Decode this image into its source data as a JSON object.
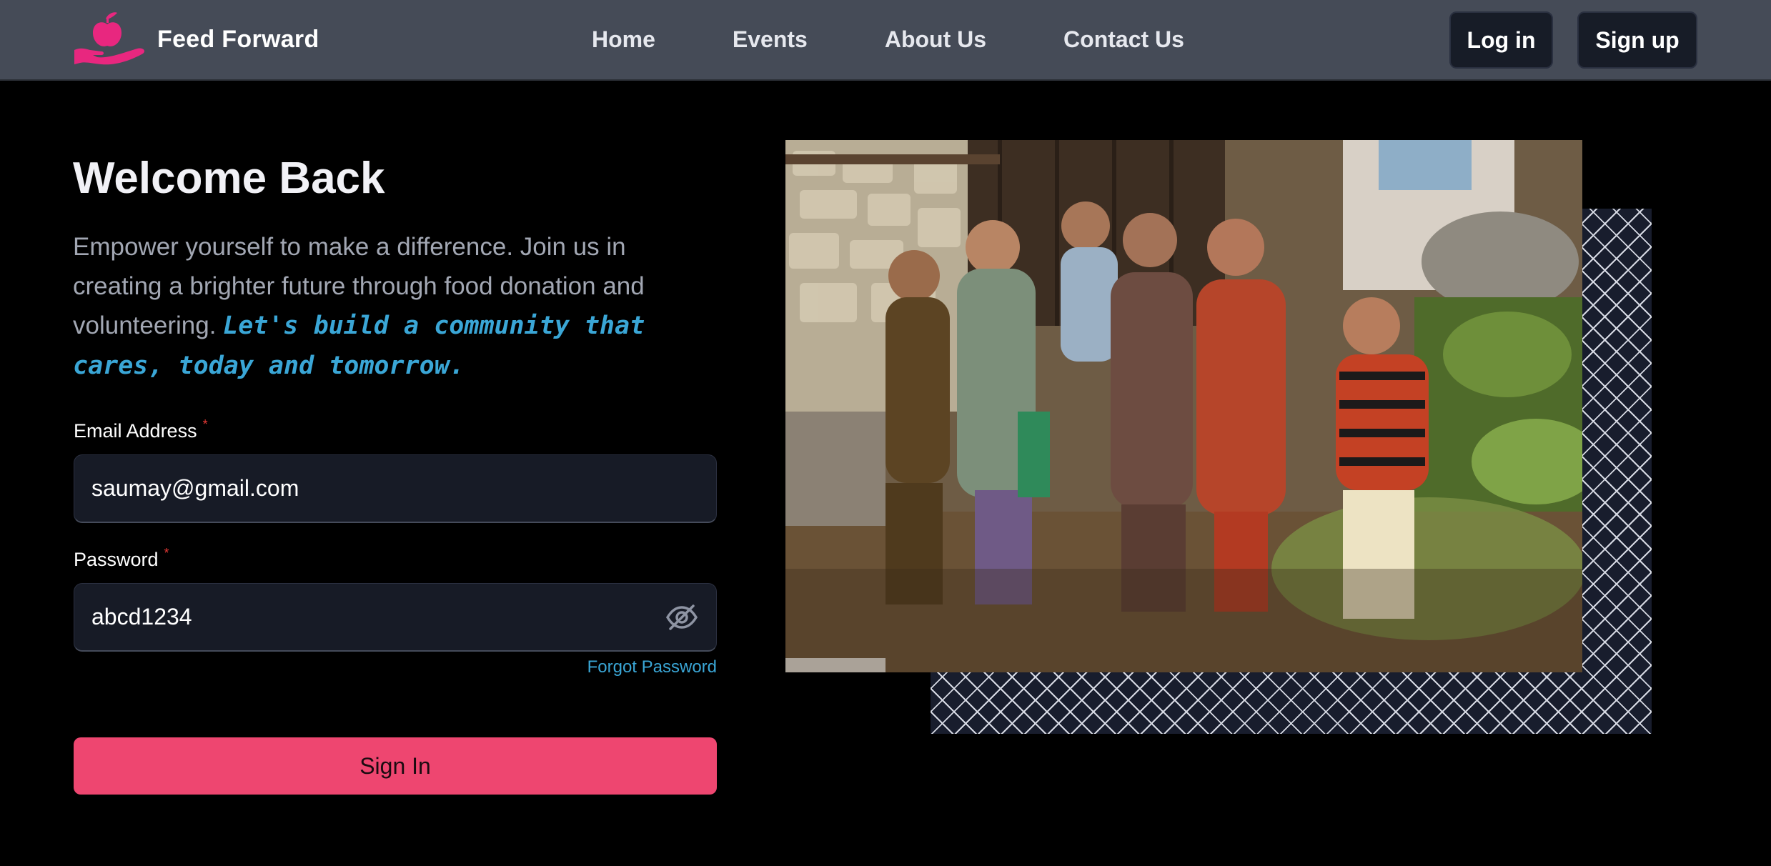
{
  "nav": {
    "brand_name": "Feed Forward",
    "logo_icon": "apple-in-hand-icon",
    "links": [
      "Home",
      "Events",
      "About Us",
      "Contact Us"
    ],
    "login_label": "Log in",
    "signup_label": "Sign up"
  },
  "form": {
    "heading": "Welcome Back",
    "intro_plain": "Empower yourself to make a difference. Join us in creating a brighter future through food donation and volunteering. ",
    "intro_accent": "Let's build a community that cares, today and tomorrow.",
    "email_label": "Email Address",
    "email_value": "saumay@gmail.com",
    "password_label": "Password",
    "password_value": "abcd1234",
    "required_marker": "*",
    "eye_icon": "eye-slash-icon",
    "forgot_label": "Forgot Password",
    "submit_label": "Sign In"
  },
  "colors": {
    "navbar_bg": "#454b57",
    "page_bg": "#000000",
    "accent_pink": "#ee4670",
    "accent_blue": "#3aa6d6",
    "input_bg": "#171b26"
  }
}
